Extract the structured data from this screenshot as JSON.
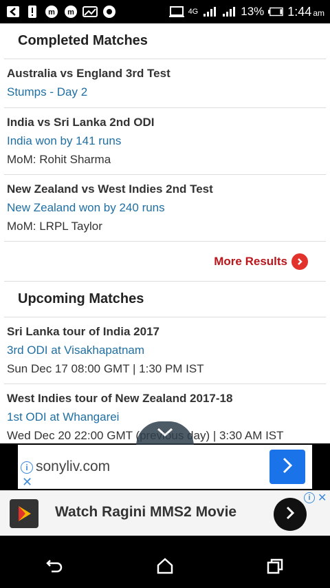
{
  "status_bar": {
    "network": "4G",
    "battery": "13%",
    "time": "1:44",
    "ampm": "am"
  },
  "completed": {
    "heading": "Completed Matches",
    "matches": [
      {
        "title": "Australia vs England 3rd Test",
        "status": "Stumps - Day 2",
        "extra": ""
      },
      {
        "title": "India vs Sri Lanka 2nd ODI",
        "status": "India won by 141 runs",
        "extra": "MoM: Rohit Sharma"
      },
      {
        "title": "New Zealand vs West Indies 2nd Test",
        "status": "New Zealand won by 240 runs",
        "extra": "MoM: LRPL Taylor"
      }
    ],
    "more_label": "More Results"
  },
  "upcoming": {
    "heading": "Upcoming Matches",
    "matches": [
      {
        "title": "Sri Lanka tour of India 2017",
        "status": "3rd ODI at Visakhapatnam",
        "extra": "Sun Dec 17 08:00 GMT | 1:30 PM IST"
      },
      {
        "title": "West Indies tour of New Zealand 2017-18",
        "status": "1st ODI at Whangarei",
        "extra": "Wed Dec 20 22:00 GMT (previous day) | 3:30 AM IST"
      }
    ]
  },
  "ads": {
    "ad1_domain": "sonyliv.com",
    "ad2_text": "Watch Ragini MMS2 Movie"
  },
  "colors": {
    "link_blue": "#1f6fa3",
    "more_red": "#b8161b",
    "ad_blue": "#1a73e8"
  }
}
